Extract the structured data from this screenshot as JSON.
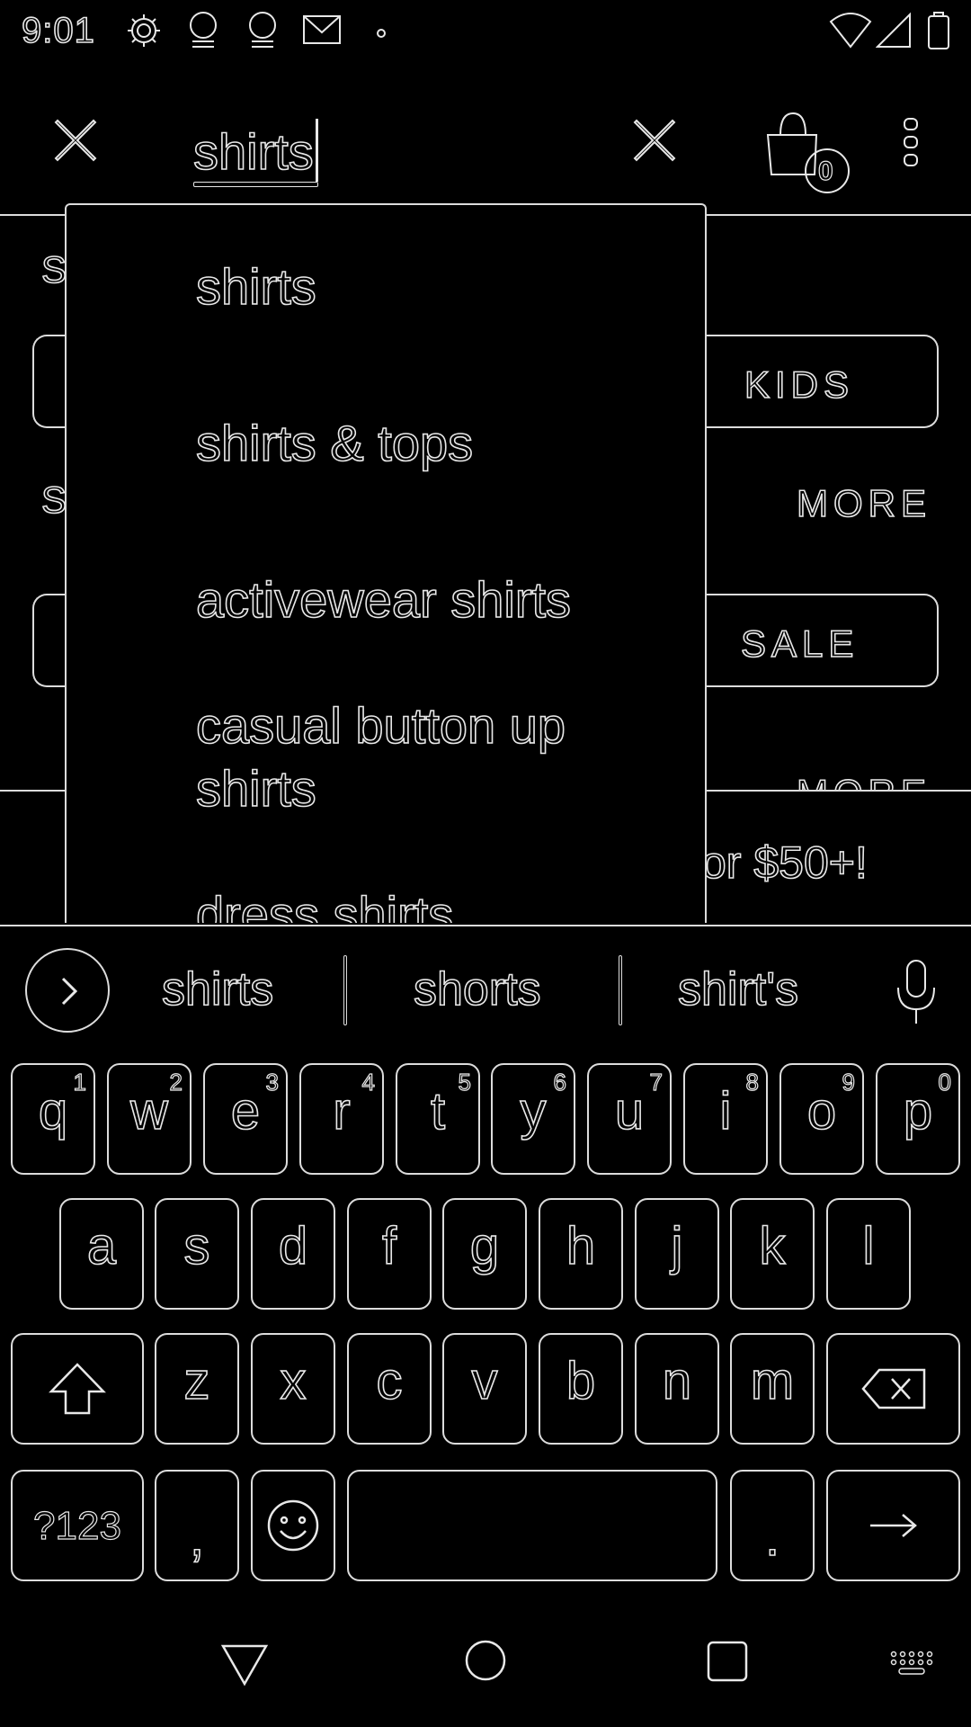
{
  "status_bar": {
    "time": "9:01",
    "icons": [
      "gear-icon",
      "abc-news-icon",
      "abc-news-icon",
      "gmail-icon",
      "dot-icon"
    ],
    "right_icons": [
      "wifi-icon",
      "cellular-icon",
      "battery-icon"
    ]
  },
  "search": {
    "query": "shirts",
    "cart_count": "0"
  },
  "background": {
    "section_letter_1": "S",
    "section_letter_2": "S",
    "kids_label": "KIDS",
    "more_label_1": "MORE",
    "sale_label": "SALE",
    "more_label_2": "MORE",
    "promo_text": "or $50+!"
  },
  "suggestions": [
    "shirts",
    "shirts & tops",
    "activewear shirts",
    "casual button up shirts",
    "dress shirts"
  ],
  "keyboard": {
    "strip_words": [
      "shirts",
      "shorts",
      "shirt's"
    ],
    "row1": [
      {
        "ch": "q",
        "num": "1"
      },
      {
        "ch": "w",
        "num": "2"
      },
      {
        "ch": "e",
        "num": "3"
      },
      {
        "ch": "r",
        "num": "4"
      },
      {
        "ch": "t",
        "num": "5"
      },
      {
        "ch": "y",
        "num": "6"
      },
      {
        "ch": "u",
        "num": "7"
      },
      {
        "ch": "i",
        "num": "8"
      },
      {
        "ch": "o",
        "num": "9"
      },
      {
        "ch": "p",
        "num": "0"
      }
    ],
    "row2": [
      "a",
      "s",
      "d",
      "f",
      "g",
      "h",
      "j",
      "k",
      "l"
    ],
    "row3": [
      "z",
      "x",
      "c",
      "v",
      "b",
      "n",
      "m"
    ],
    "symbols_label": "?123",
    "comma_label": ",",
    "period_label": "."
  },
  "colors": {
    "background": "#000000",
    "outline": "#e8e8e8"
  }
}
